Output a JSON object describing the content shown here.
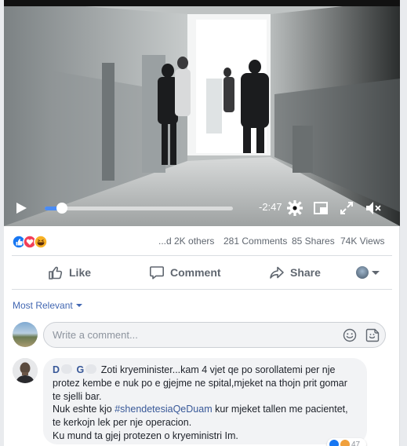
{
  "video": {
    "time_remaining": "-2:47",
    "progress_fraction": 0.09
  },
  "stats": {
    "reactions_text": "...d 2K others",
    "comments": "281 Comments",
    "shares": "85 Shares",
    "views": "74K Views"
  },
  "actions": {
    "like": "Like",
    "comment": "Comment",
    "share": "Share"
  },
  "comments_section": {
    "filter_label": "Most Relevant",
    "composer_placeholder": "Write a comment...",
    "comment": {
      "author_initial_1": "D",
      "author_initial_2": "G",
      "line1_rest": "Zoti kryeminister...kam 4 vjet qe po sorollatemi per nje",
      "line2": "protez kembe e nuk po e gjejme ne spital,mjeket na thojn prit gomar",
      "line3": "te sjelli bar.",
      "line4_before": "Nuk eshte kjo ",
      "line4_hashtag": "#shendetesiaQeDuam",
      "line4_after": " kur mjeket tallen me pacientet,",
      "line5": "te kerkojn lek per nje operacion.",
      "line6": "Ku mund ta gjej protezen o kryeministri Im.",
      "reaction_count": "47"
    }
  },
  "colors": {
    "accent": "#4267b2",
    "progress": "#4a8cf5",
    "like_blue": "#1877f2",
    "love_red": "#f33e58",
    "haha_yellow": "#f7b125"
  }
}
